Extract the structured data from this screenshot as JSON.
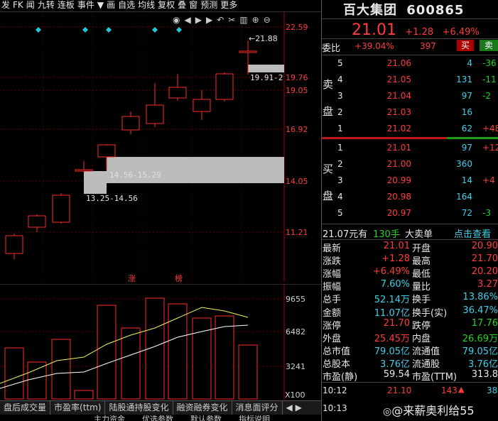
{
  "toolbar": [
    "发",
    "FK",
    "闻",
    "九转",
    "连板",
    "事件",
    "▼",
    "画",
    "自选",
    "均线",
    "复权",
    "叠",
    "窗",
    "预测",
    "更多"
  ],
  "toolbar_icons": [
    "eye-icon",
    "circle-left-icon",
    "play-icon",
    "circle-right-icon",
    "undo-icon",
    "cut-icon",
    "trash-icon",
    "zoom-in-icon",
    "zoom-out-icon"
  ],
  "main": {
    "y_labels": [
      "22.59",
      "19.76",
      "19.05",
      "16.92",
      "14.05",
      "11.21"
    ],
    "annotations": {
      "high": "←21.88",
      "zone_top": "19.91-2",
      "zone_mid": "14.56-15.29",
      "zone_low": "13.25-14.56"
    },
    "markers": [
      "涨",
      "榜"
    ]
  },
  "volume": {
    "y_labels": [
      "9655",
      "6482",
      "3241"
    ],
    "unit": "X100"
  },
  "tabs": [
    "盘后成交量",
    "市盈率(ttm)",
    "陆股通持股变化",
    "融资融券变化",
    "消息面评分"
  ],
  "tabs2": [
    "主力资金",
    "优选参数",
    "默认参数",
    "指标说明"
  ],
  "quote": {
    "name": "百大集团",
    "code": "600865",
    "price": "21.01",
    "change": "+1.28",
    "pct": "+6.49%",
    "weibi_label": "委比",
    "weibi": "+39.04%",
    "weicha": "397",
    "buy_btn": "买",
    "sell_btn": "卖",
    "sell_label": [
      "卖",
      "盘"
    ],
    "buy_label": [
      "买",
      "盘"
    ],
    "asks": [
      {
        "level": "5",
        "price": "21.06",
        "vol": "4",
        "chg": "-36"
      },
      {
        "level": "4",
        "price": "21.05",
        "vol": "131",
        "chg": "-11"
      },
      {
        "level": "3",
        "price": "21.04",
        "vol": "97",
        "chg": "-2"
      },
      {
        "level": "2",
        "price": "21.03",
        "vol": "16",
        "chg": ""
      },
      {
        "level": "1",
        "price": "21.02",
        "vol": "62",
        "chg": "+48"
      }
    ],
    "bids": [
      {
        "level": "1",
        "price": "21.01",
        "vol": "97",
        "chg": "+12"
      },
      {
        "level": "2",
        "price": "21.00",
        "vol": "360",
        "chg": ""
      },
      {
        "level": "3",
        "price": "20.99",
        "vol": "14",
        "chg": "+4"
      },
      {
        "level": "4",
        "price": "20.98",
        "vol": "164",
        "chg": ""
      },
      {
        "level": "5",
        "price": "20.97",
        "vol": "72",
        "chg": "-3"
      }
    ],
    "big_order": {
      "price": "21.07元有",
      "vol": "130手",
      "label": "大卖单",
      "link": "点击查看"
    },
    "stats_left": [
      {
        "k": "最新",
        "v": "21.01",
        "c": "red"
      },
      {
        "k": "涨跌",
        "v": "+1.28",
        "c": "red"
      },
      {
        "k": "涨幅",
        "v": "+6.49%",
        "c": "red"
      },
      {
        "k": "振幅",
        "v": "7.60%",
        "c": "cyan"
      },
      {
        "k": "总手",
        "v": "52.14万",
        "c": "cyan"
      },
      {
        "k": "金额",
        "v": "11.07亿",
        "c": "cyan"
      },
      {
        "k": "涨停",
        "v": "21.70",
        "c": "red"
      },
      {
        "k": "外盘",
        "v": "25.45万",
        "c": "red"
      },
      {
        "k": "总市值",
        "v": "79.05亿",
        "c": "cyan"
      },
      {
        "k": "总股本",
        "v": "3.76亿",
        "c": "cyan"
      },
      {
        "k": "市盈(静)",
        "v": "59.54",
        "c": "white"
      }
    ],
    "stats_right": [
      {
        "k": "开盘",
        "v": "20.90",
        "c": "red"
      },
      {
        "k": "最高",
        "v": "21.70",
        "c": "red"
      },
      {
        "k": "最低",
        "v": "20.20",
        "c": "red"
      },
      {
        "k": "量比",
        "v": "3.27",
        "c": "red"
      },
      {
        "k": "换手",
        "v": "13.86%",
        "c": "cyan"
      },
      {
        "k": "换手(实)",
        "v": "36.47%",
        "c": "cyan"
      },
      {
        "k": "跌停",
        "v": "17.76",
        "c": "green"
      },
      {
        "k": "内盘",
        "v": "26.69万",
        "c": "green"
      },
      {
        "k": "流通值",
        "v": "79.05亿",
        "c": "cyan"
      },
      {
        "k": "流通股",
        "v": "3.76亿",
        "c": "cyan"
      },
      {
        "k": "市盈(TTM)",
        "v": "313.8",
        "c": "white"
      }
    ],
    "ticks": [
      {
        "time": "10:12",
        "price": "21.10",
        "vol": "143",
        "extra": "38"
      },
      {
        "time": "10:13",
        "price": "",
        "vol": "",
        "extra": ""
      }
    ],
    "watermark": "@来薪奥利给55"
  }
}
